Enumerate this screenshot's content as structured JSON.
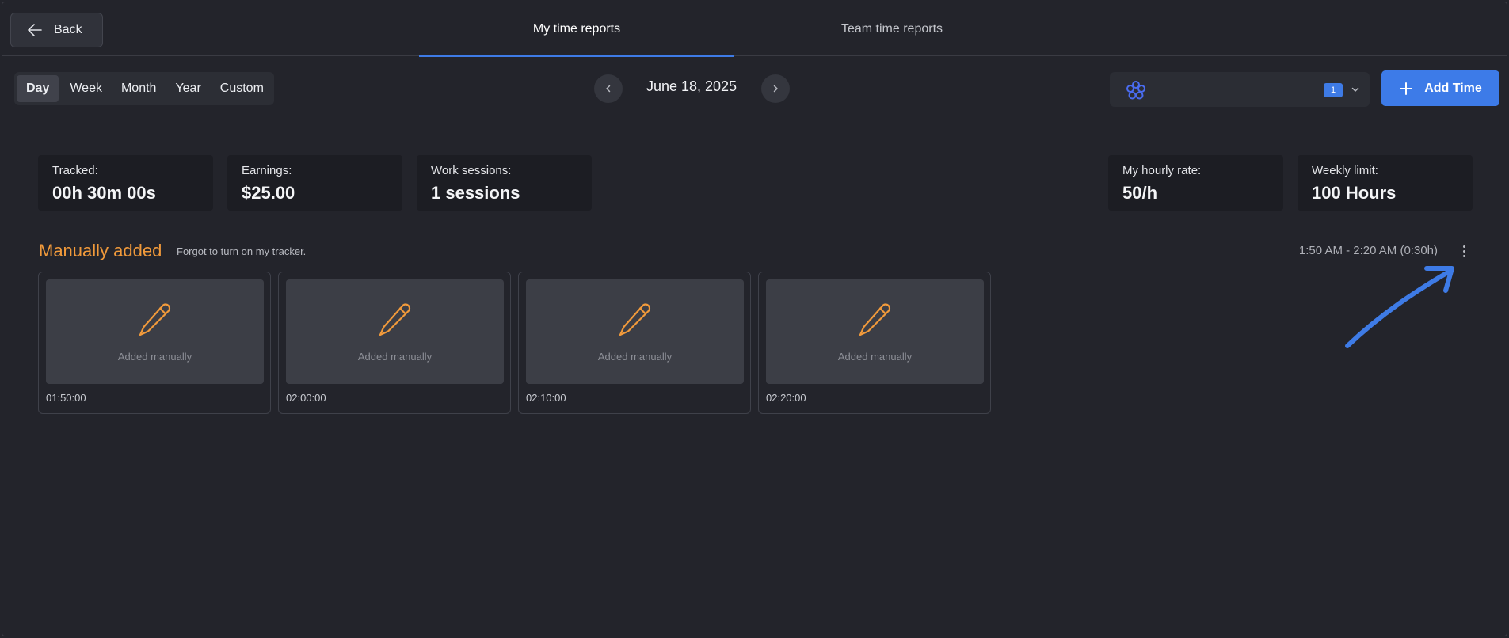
{
  "header": {
    "back_label": "Back",
    "tabs": [
      {
        "label": "My time reports",
        "active": true
      },
      {
        "label": "Team time reports",
        "active": false
      }
    ]
  },
  "toolbar": {
    "periods": [
      "Day",
      "Week",
      "Month",
      "Year",
      "Custom"
    ],
    "active_period": "Day",
    "date": "June 18, 2025",
    "team_member_count": "1",
    "add_time_label": "Add Time"
  },
  "stats": [
    {
      "label": "Tracked:",
      "value": "00h 30m 00s"
    },
    {
      "label": "Earnings:",
      "value": "$25.00"
    },
    {
      "label": "Work sessions:",
      "value": "1 sessions"
    },
    {
      "label": "My hourly rate:",
      "value": "50/h"
    },
    {
      "label": "Weekly limit:",
      "value": "100 Hours"
    }
  ],
  "session": {
    "title": "Manually added",
    "note": "Forgot to turn on my tracker.",
    "time_range": "1:50 AM - 2:20 AM (0:30h)",
    "screenshots": [
      {
        "caption": "Added manually",
        "time": "01:50:00"
      },
      {
        "caption": "Added manually",
        "time": "02:00:00"
      },
      {
        "caption": "Added manually",
        "time": "02:10:00"
      },
      {
        "caption": "Added manually",
        "time": "02:20:00"
      }
    ]
  },
  "colors": {
    "accent": "#3e7be6",
    "session_title": "#f19a3b",
    "background": "#23242b",
    "card": "#1c1d23"
  },
  "icons": [
    "arrow-left-icon",
    "chevron-left-icon",
    "chevron-right-icon",
    "team-logo-icon",
    "chevron-down-icon",
    "plus-icon",
    "pencil-icon",
    "kebab-menu-icon"
  ]
}
